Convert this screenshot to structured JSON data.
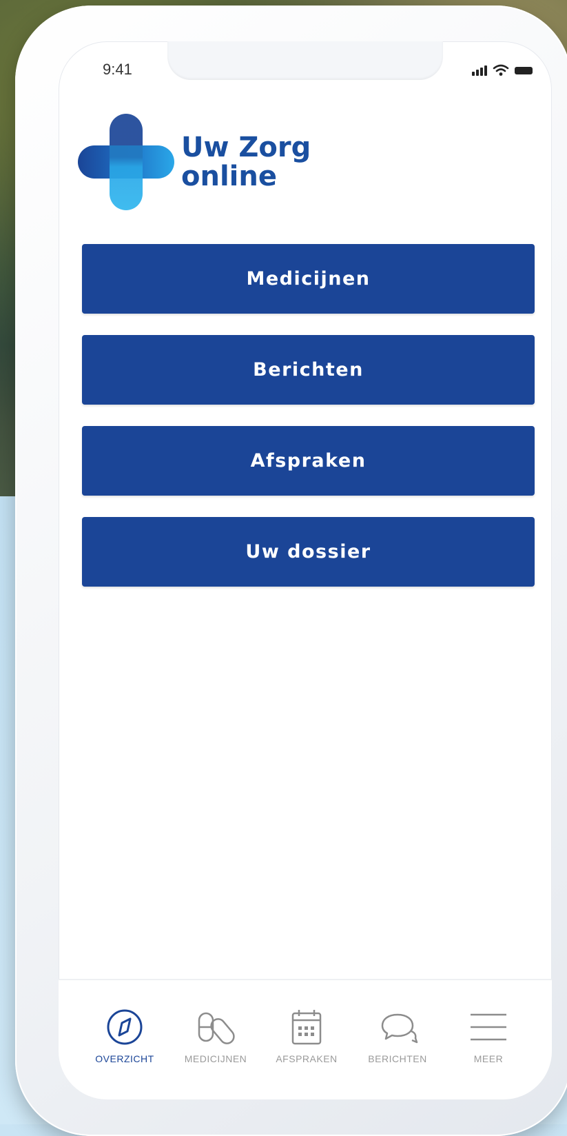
{
  "status_bar": {
    "time": "9:41"
  },
  "brand": {
    "line1": "Uw Zorg",
    "line2": "online",
    "primary_color": "#1b4597",
    "accent_color": "#2aa7e8"
  },
  "menu": {
    "items": [
      {
        "label": "Medicijnen"
      },
      {
        "label": "Berichten"
      },
      {
        "label": "Afspraken"
      },
      {
        "label": "Uw dossier"
      }
    ]
  },
  "tabbar": {
    "active": "OVERZICHT",
    "tabs": [
      {
        "label": "OVERZICHT",
        "icon": "compass-icon"
      },
      {
        "label": "MEDICIJNEN",
        "icon": "pills-icon"
      },
      {
        "label": "AFSPRAKEN",
        "icon": "calendar-icon"
      },
      {
        "label": "BERICHTEN",
        "icon": "chat-bubbles-icon"
      },
      {
        "label": "MEER",
        "icon": "hamburger-menu-icon"
      }
    ]
  }
}
